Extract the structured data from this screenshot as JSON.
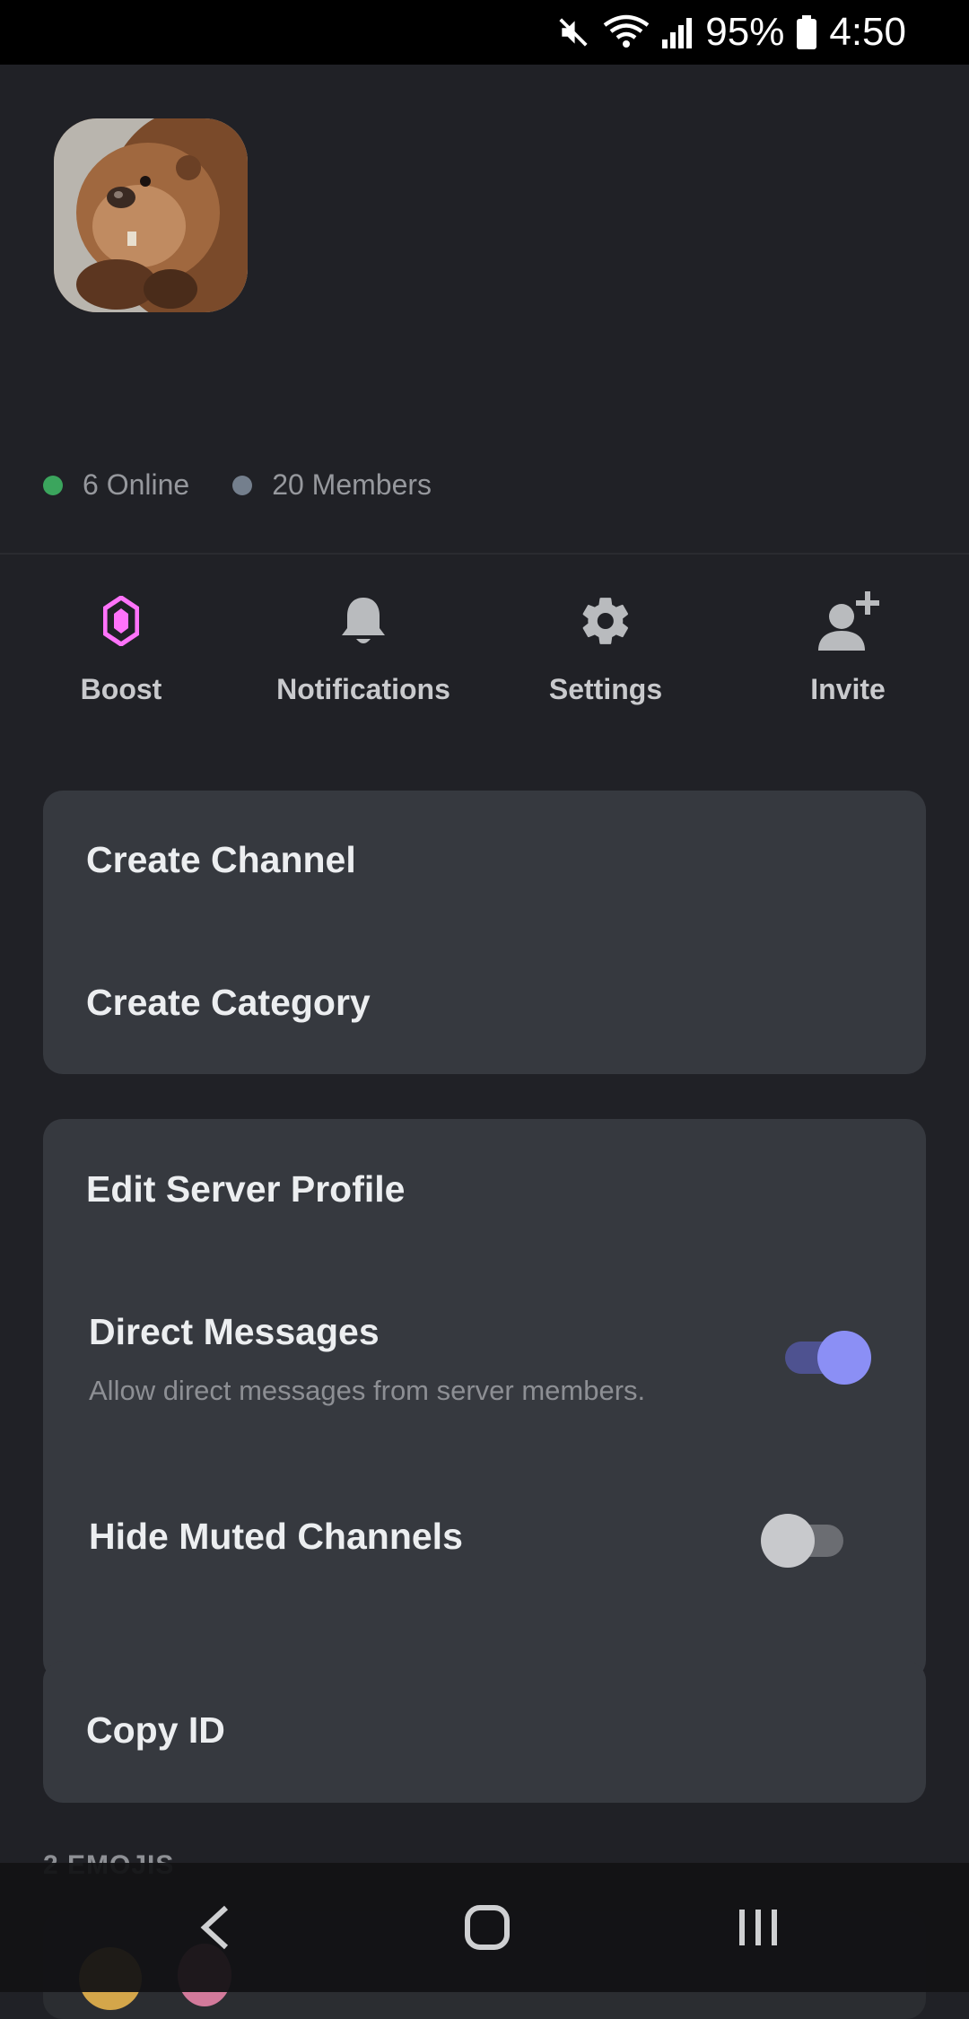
{
  "status_bar": {
    "battery": "95%",
    "time": "4:50"
  },
  "server": {
    "online_count": "6 Online",
    "member_count": "20 Members",
    "colors": {
      "online": "#3ba55d",
      "members": "#747f8d"
    }
  },
  "actions": [
    {
      "label": "Boost",
      "icon": "boost-gem-icon",
      "color": "#ff73fa"
    },
    {
      "label": "Notifications",
      "icon": "bell-icon",
      "color": "#b9bbbe"
    },
    {
      "label": "Settings",
      "icon": "gear-icon",
      "color": "#b9bbbe"
    },
    {
      "label": "Invite",
      "icon": "add-user-icon",
      "color": "#b9bbbe"
    }
  ],
  "menu": {
    "create_channel": "Create Channel",
    "create_category": "Create Category",
    "edit_server_profile": "Edit Server Profile",
    "direct_messages": {
      "label": "Direct Messages",
      "description": "Allow direct messages from server members.",
      "enabled": true
    },
    "hide_muted_channels": {
      "label": "Hide Muted Channels",
      "enabled": false
    },
    "copy_id": "Copy ID"
  },
  "emojis": {
    "section_label": "2 EMOJIS"
  },
  "accent_color": "#7c83f5"
}
